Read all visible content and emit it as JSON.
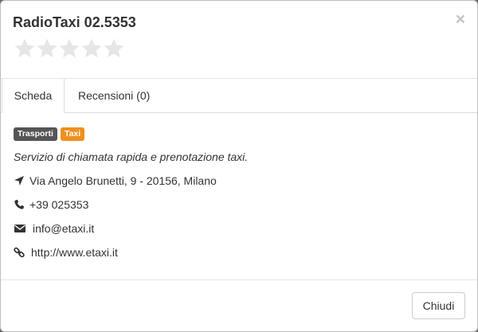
{
  "modal": {
    "title": "RadioTaxi 02.5353",
    "close_symbol": "×",
    "rating": {
      "stars_total": 5,
      "stars_filled": 0,
      "star_color": "#e6e6e6"
    }
  },
  "tabs": [
    {
      "label": "Scheda",
      "active": true
    },
    {
      "label": "Recensioni (0)",
      "active": false
    }
  ],
  "labels": [
    {
      "text": "Trasporti",
      "color": "#555555"
    },
    {
      "text": "Taxi",
      "color": "#f0901e"
    }
  ],
  "description": "Servizio di chiamata rapida e prenotazione taxi.",
  "info": {
    "address": {
      "icon": "location-arrow-icon",
      "text": "Via Angelo Brunetti, 9 - 20156, Milano"
    },
    "phone": {
      "icon": "phone-icon",
      "text": "+39 025353"
    },
    "email": {
      "icon": "envelope-icon",
      "text": "info@etaxi.it"
    },
    "website": {
      "icon": "link-icon",
      "text": "http://www.etaxi.it"
    }
  },
  "footer": {
    "close_label": "Chiudi"
  }
}
